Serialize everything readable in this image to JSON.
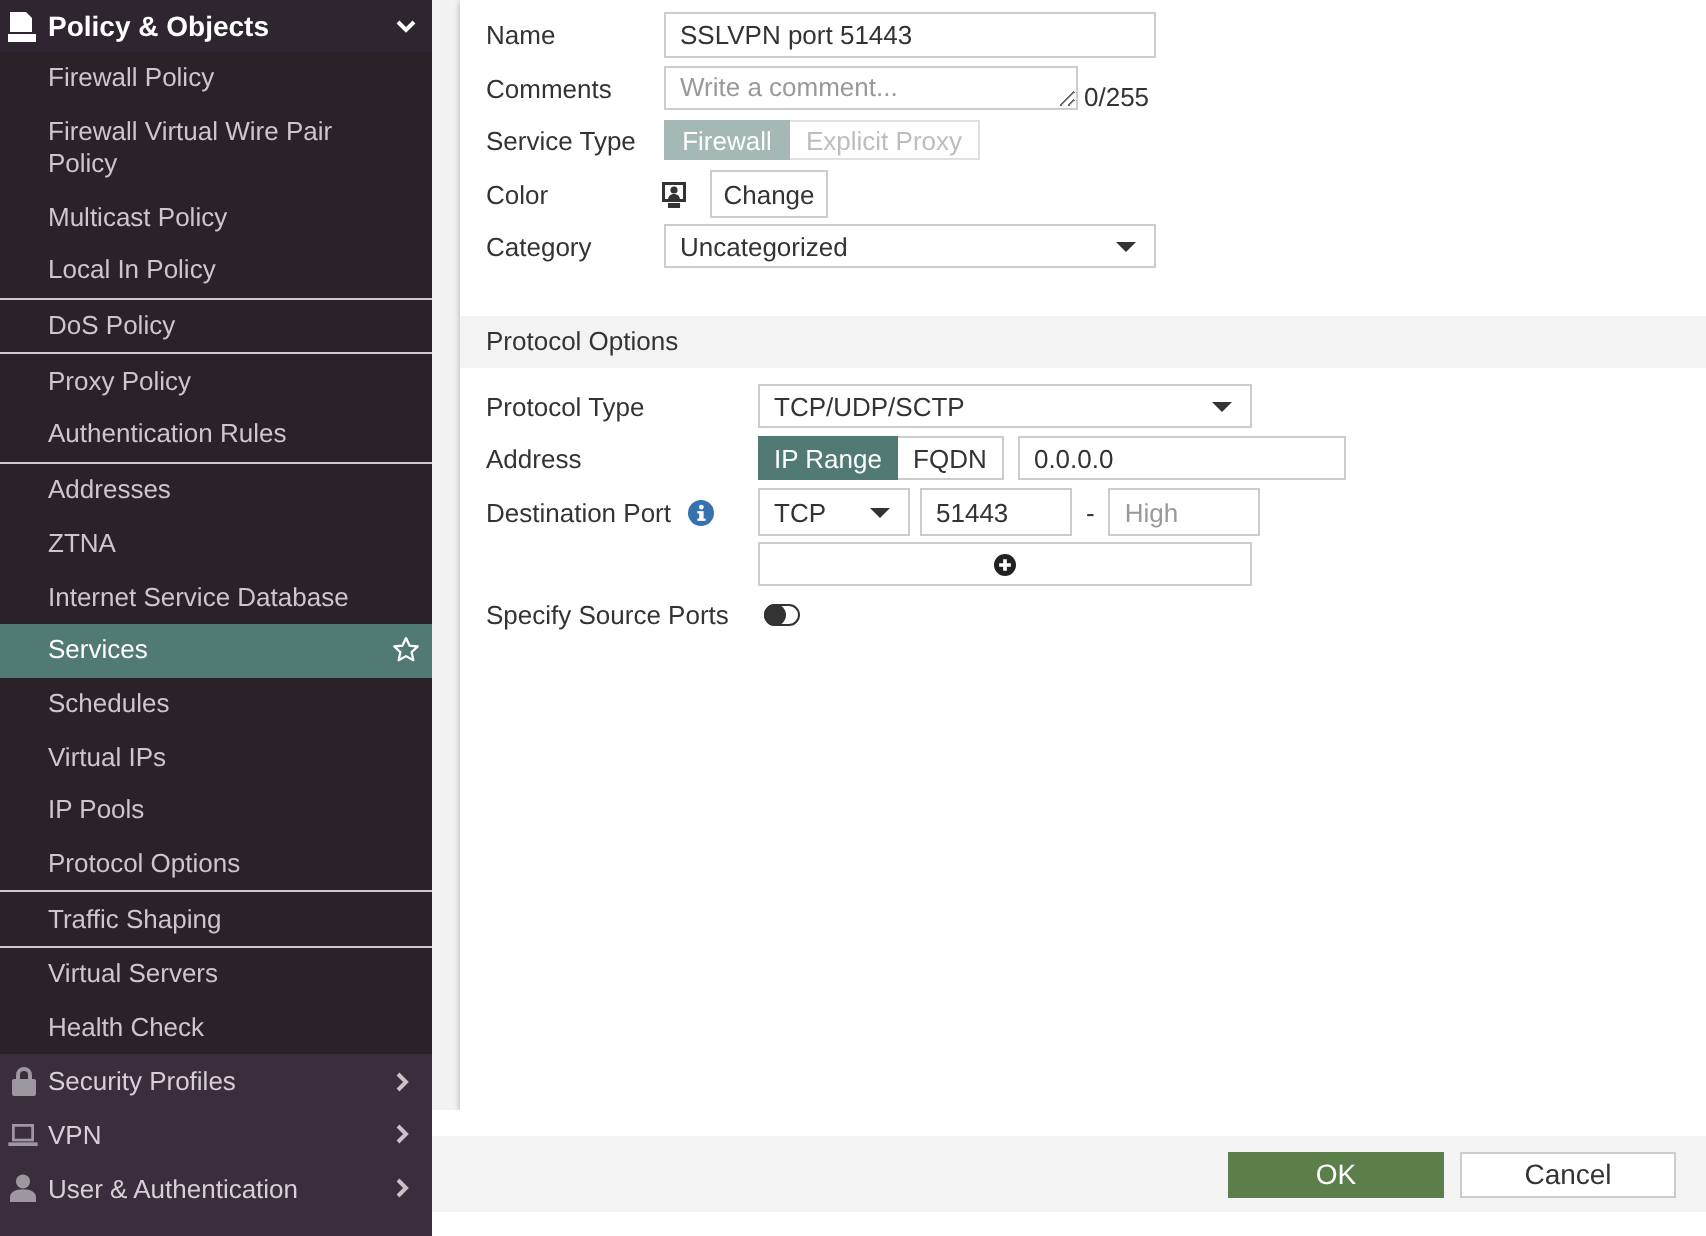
{
  "sidebar": {
    "header": {
      "label": "Policy & Objects",
      "expanded": true
    },
    "groups": [
      {
        "items": [
          {
            "label": "Firewall Policy",
            "selected": false
          },
          {
            "label": "Firewall Virtual Wire Pair Policy",
            "selected": false
          },
          {
            "label": "Multicast Policy",
            "selected": false
          },
          {
            "label": "Local In Policy",
            "selected": false
          }
        ]
      },
      {
        "items": [
          {
            "label": "DoS Policy",
            "selected": false
          }
        ]
      },
      {
        "items": [
          {
            "label": "Proxy Policy",
            "selected": false
          },
          {
            "label": "Authentication Rules",
            "selected": false
          }
        ]
      },
      {
        "items": [
          {
            "label": "Addresses",
            "selected": false
          },
          {
            "label": "ZTNA",
            "selected": false
          },
          {
            "label": "Internet Service Database",
            "selected": false
          },
          {
            "label": "Services",
            "selected": true
          },
          {
            "label": "Schedules",
            "selected": false
          },
          {
            "label": "Virtual IPs",
            "selected": false
          },
          {
            "label": "IP Pools",
            "selected": false
          },
          {
            "label": "Protocol Options",
            "selected": false
          }
        ]
      },
      {
        "items": [
          {
            "label": "Traffic Shaping",
            "selected": false
          }
        ]
      },
      {
        "items": [
          {
            "label": "Virtual Servers",
            "selected": false
          },
          {
            "label": "Health Check",
            "selected": false
          }
        ]
      }
    ],
    "sections": [
      {
        "label": "Security Profiles",
        "expanded": false
      },
      {
        "label": "VPN",
        "expanded": false
      },
      {
        "label": "User & Authentication",
        "expanded": false
      }
    ]
  },
  "form": {
    "name": {
      "label": "Name",
      "value": "SSLVPN port 51443"
    },
    "comments": {
      "label": "Comments",
      "placeholder": "Write a comment...",
      "counter": "0/255"
    },
    "service_type": {
      "label": "Service Type",
      "disabled": true,
      "options": [
        {
          "label": "Firewall",
          "selected": true
        },
        {
          "label": "Explicit Proxy",
          "selected": false
        }
      ]
    },
    "color": {
      "label": "Color",
      "button": "Change"
    },
    "category": {
      "label": "Category",
      "value": "Uncategorized"
    }
  },
  "protocol_options": {
    "title": "Protocol Options",
    "protocol_type": {
      "label": "Protocol Type",
      "value": "TCP/UDP/SCTP"
    },
    "address": {
      "label": "Address",
      "options": [
        {
          "label": "IP Range",
          "selected": true
        },
        {
          "label": "FQDN",
          "selected": false
        }
      ],
      "value": "0.0.0.0"
    },
    "destination_port": {
      "label": "Destination Port",
      "protocol": "TCP",
      "low": "51443",
      "separator": "-",
      "high": {
        "placeholder": "High"
      }
    },
    "specify_source_ports": {
      "label": "Specify Source Ports",
      "on": false
    }
  },
  "footer": {
    "buttons": [
      {
        "label": "OK",
        "kind": "primary"
      },
      {
        "label": "Cancel",
        "kind": "secondary"
      }
    ]
  }
}
